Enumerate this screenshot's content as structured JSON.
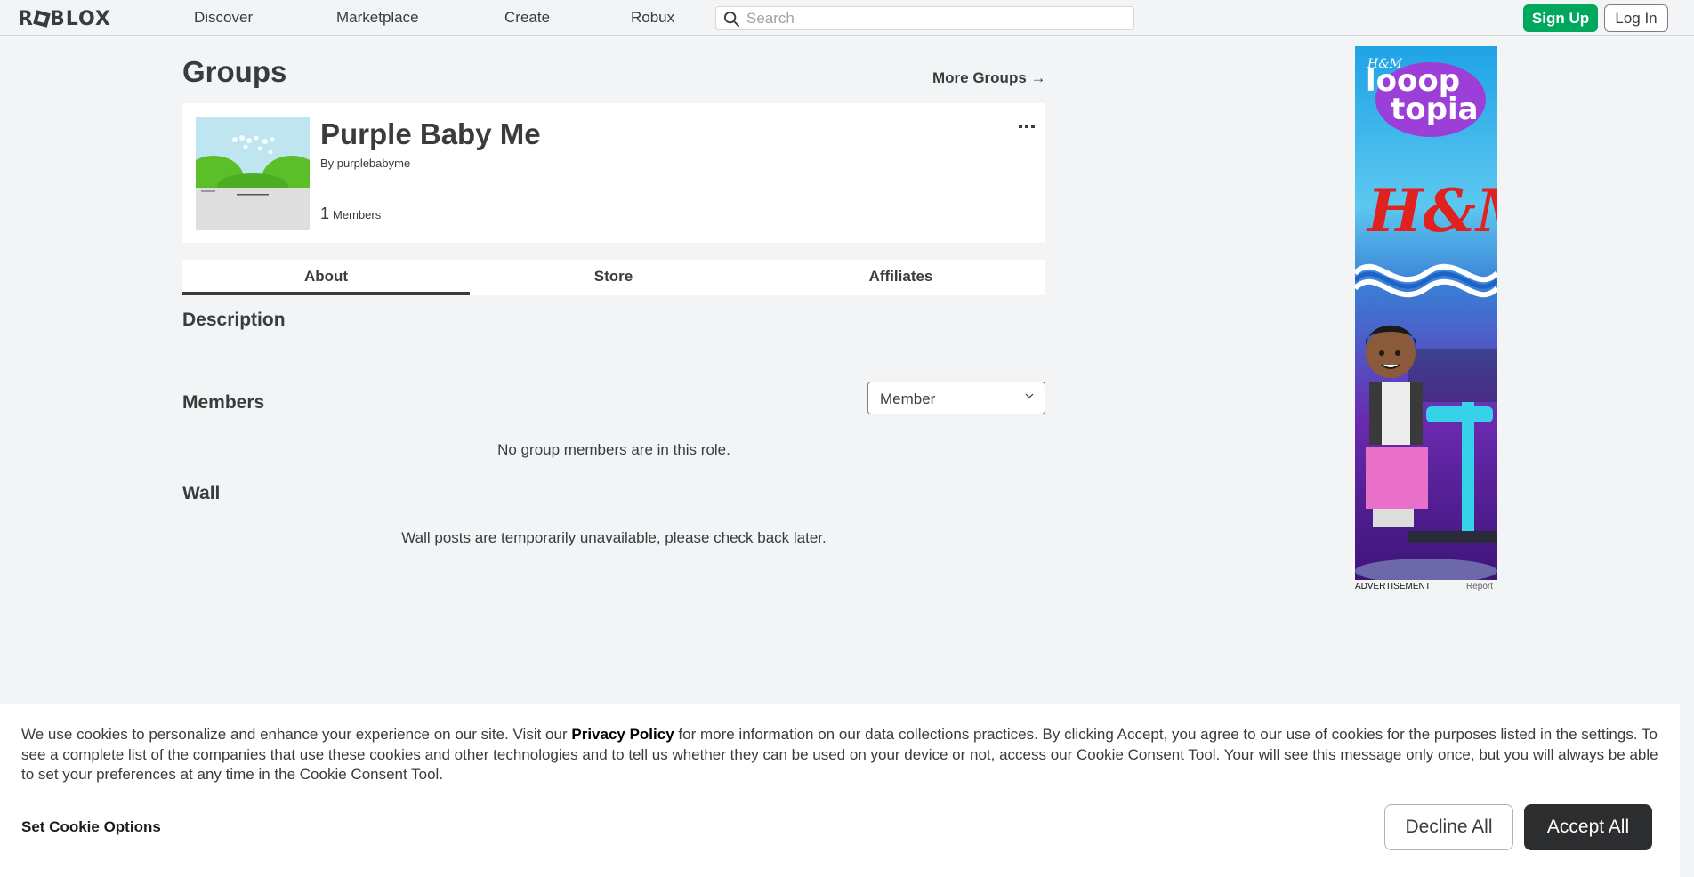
{
  "nav": {
    "logo": "ROBLOX",
    "links": [
      "Discover",
      "Marketplace",
      "Create",
      "Robux"
    ],
    "search_placeholder": "Search",
    "signup_label": "Sign Up",
    "login_label": "Log In"
  },
  "page": {
    "title": "Groups",
    "more_groups": "More Groups →"
  },
  "group": {
    "name": "Purple Baby Me",
    "by_label": "By",
    "owner": "purplebabyme",
    "member_count": "1",
    "members_label": "Members",
    "menu_icon": "ellipsis-icon"
  },
  "tabs": [
    "About",
    "Store",
    "Affiliates"
  ],
  "about": {
    "description_heading": "Description",
    "members_heading": "Members",
    "role_selected": "Member",
    "no_members_msg": "No group members are in this role.",
    "wall_heading": "Wall",
    "wall_msg": "Wall posts are temporarily unavailable, please check back later."
  },
  "ad": {
    "label": "ADVERTISEMENT",
    "report": "Report",
    "brand_small": "H&M",
    "headline_line1": "looop",
    "headline_line2": "topia",
    "brand_big": "H&M"
  },
  "cookie": {
    "text_before": "We use cookies to personalize and enhance your experience on our site. Visit our ",
    "privacy_link": "Privacy Policy",
    "text_after": " for more information on our data collections practices. By clicking Accept, you agree to our use of cookies for the purposes listed in the settings. To see a complete list of the companies that use these cookies and other technologies and to tell us whether they can be used on your device or not, access our Cookie Consent Tool. Your will see this message only once, but you will always be able to set your preferences at any time in the Cookie Consent Tool.",
    "set_options": "Set Cookie Options",
    "decline": "Decline All",
    "accept": "Accept All"
  },
  "colors": {
    "accent_green": "#00a85e",
    "text_dark": "#393b3d",
    "page_bg": "#f2f4f5",
    "accept_bg": "#2b2d2f"
  }
}
